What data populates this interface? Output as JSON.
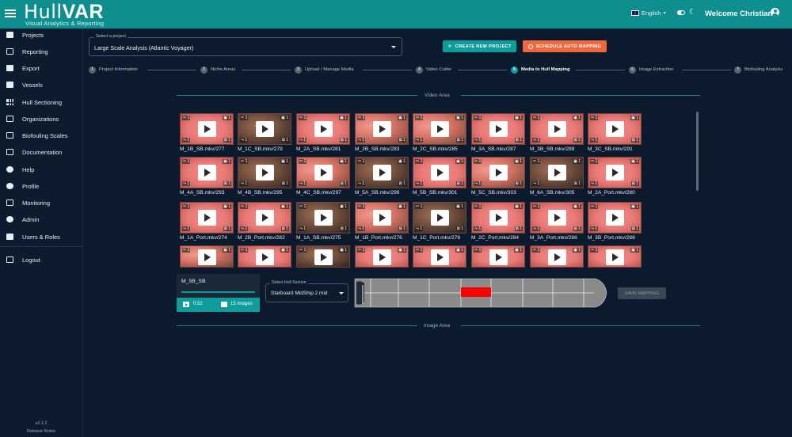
{
  "header": {
    "logo_text": "Hull",
    "logo_text_bold": "VAR",
    "logo_subtitle": "Visual Analytics & Reporting",
    "language": "English",
    "welcome": "Welcome Christian"
  },
  "sidebar": {
    "items": [
      {
        "label": "Projects",
        "icon": "video-camera-icon"
      },
      {
        "label": "Reporting",
        "icon": "line-chart-icon"
      },
      {
        "label": "Export",
        "icon": "truck-icon"
      },
      {
        "label": "Vessels",
        "icon": "ship-icon"
      },
      {
        "label": "Hull Sectioning",
        "icon": "grid-icon"
      },
      {
        "label": "Organizations",
        "icon": "org-chart-icon"
      },
      {
        "label": "Biofouling Scales",
        "icon": "ruler-icon"
      },
      {
        "label": "Documentation",
        "icon": "book-icon"
      },
      {
        "label": "Help",
        "icon": "help-icon"
      },
      {
        "label": "Profile",
        "icon": "account-icon"
      },
      {
        "label": "Monitoring",
        "icon": "monitoring-icon"
      },
      {
        "label": "Admin",
        "icon": "gear-icon"
      },
      {
        "label": "Users & Roles",
        "icon": "users-icon"
      }
    ],
    "logout": "Logout",
    "version": "v2.1.2",
    "release_notes": "Release Notes"
  },
  "project": {
    "caption": "Select a project",
    "value": "Large Scale Analysis (Atlantic Voyager)",
    "create_label": "CREATE NEW PROJECT",
    "schedule_label": "SCHEDULE AUTO MAPPING"
  },
  "steps": [
    {
      "num": "1",
      "label": "Project Information"
    },
    {
      "num": "2",
      "label": "Niche Areas"
    },
    {
      "num": "3",
      "label": "Upload / Manage Media"
    },
    {
      "num": "4",
      "label": "Video Cutter"
    },
    {
      "num": "5",
      "label": "Media to Hull Mapping"
    },
    {
      "num": "6",
      "label": "Image Extraction"
    },
    {
      "num": "7",
      "label": "Biofouling Analysis"
    }
  ],
  "video_area_title": "Video Area",
  "image_area_title": "Image Area",
  "videos": [
    "M_1B_SB.mkv/277",
    "M_1C_SB.mkv/279",
    "M_2A_SB.mkv/281",
    "M_2B_SB.mkv/283",
    "M_2C_SB.mkv/285",
    "M_3A_SB.mkv/287",
    "M_3B_SB.mkv/289",
    "M_3C_SB.mkv/291",
    "M_4A_SB.mkv/293",
    "M_4B_SB.mkv/295",
    "M_4C_SB.mkv/297",
    "M_5A_SB.mkv/299",
    "M_5B_SB.mkv/301",
    "M_5C_SB.mkv/303",
    "M_6A_SB.mkv/305",
    "M_2A_Port.mkv/280",
    "M_1A_Port.mkv/274",
    "M_2B_Port.mkv/282",
    "M_1A_SB.mkv/275",
    "M_1B_Port.mkv/276",
    "M_1C_Port.mkv/278",
    "M_2C_Port.mkv/284",
    "M_3A_Port.mkv/286",
    "M_3B_Port.mkv/288",
    "",
    "",
    "",
    "",
    "",
    "",
    "",
    ""
  ],
  "badge": "1",
  "selected": {
    "name": "M_5B_SB",
    "duration": "0:52",
    "images": "15 images"
  },
  "hull_section": {
    "caption": "Select Hull Section",
    "value": "Starboard MidShip 2 mid"
  },
  "save_mapping": "SAVE MAPPING",
  "colors": {
    "header": "#0e8e8e",
    "accent": "#0e9d9a",
    "orange": "#f1683f",
    "highlight": "#ff0000"
  }
}
